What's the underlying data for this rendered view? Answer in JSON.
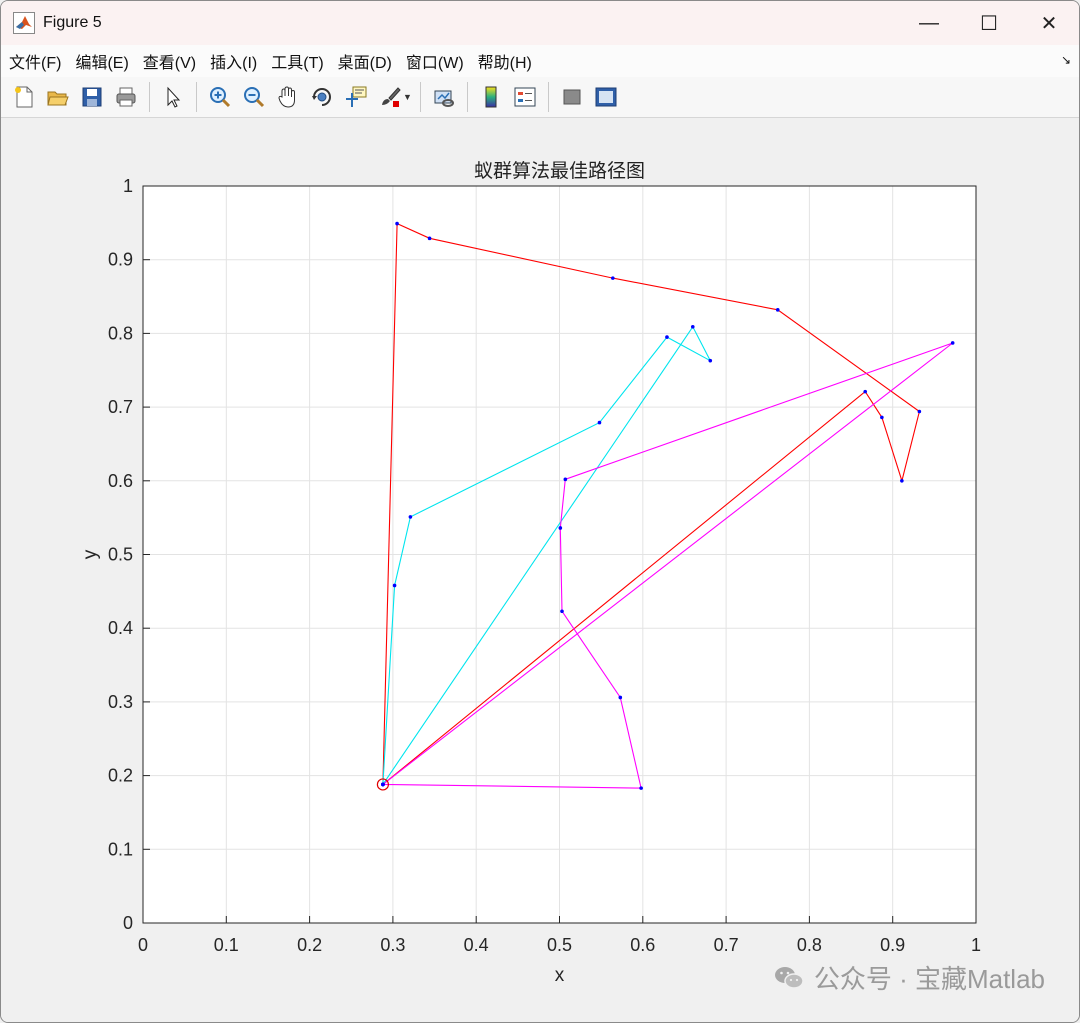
{
  "window": {
    "title": "Figure 5",
    "minimize": "—",
    "maximize": "☐",
    "close": "✕"
  },
  "menu": {
    "items": [
      "文件(F)",
      "编辑(E)",
      "查看(V)",
      "插入(I)",
      "工具(T)",
      "桌面(D)",
      "窗口(W)",
      "帮助(H)"
    ],
    "expand": "↘"
  },
  "toolbar": {
    "buttons": [
      "new-figure-icon",
      "open-file-icon",
      "save-icon",
      "print-icon",
      "pointer-icon",
      "zoom-in-icon",
      "zoom-out-icon",
      "pan-hand-icon",
      "rotate-3d-icon",
      "data-cursor-icon",
      "brush-icon",
      "link-plot-icon",
      "colorbar-icon",
      "legend-icon",
      "hide-plot-tools-icon",
      "show-plot-tools-icon"
    ]
  },
  "chart_data": {
    "type": "line",
    "title": "蚁群算法最佳路径图",
    "xlabel": "x",
    "ylabel": "y",
    "xlim": [
      0,
      1
    ],
    "ylim": [
      0,
      1
    ],
    "xticks": [
      "0",
      "0.1",
      "0.2",
      "0.3",
      "0.4",
      "0.5",
      "0.6",
      "0.7",
      "0.8",
      "0.9",
      "1"
    ],
    "yticks": [
      "0",
      "0.1",
      "0.2",
      "0.3",
      "0.4",
      "0.5",
      "0.6",
      "0.7",
      "0.8",
      "0.9",
      "1"
    ],
    "grid": true,
    "depot": {
      "x": 0.288,
      "y": 0.188
    },
    "series": [
      {
        "color": "#ff0000",
        "points": [
          [
            0.288,
            0.188
          ],
          [
            0.305,
            0.949
          ],
          [
            0.344,
            0.929
          ],
          [
            0.564,
            0.875
          ],
          [
            0.762,
            0.832
          ],
          [
            0.932,
            0.694
          ],
          [
            0.911,
            0.6
          ],
          [
            0.887,
            0.686
          ],
          [
            0.867,
            0.721
          ],
          [
            0.288,
            0.188
          ]
        ]
      },
      {
        "color": "#00e5ee",
        "points": [
          [
            0.288,
            0.188
          ],
          [
            0.302,
            0.458
          ],
          [
            0.321,
            0.551
          ],
          [
            0.548,
            0.679
          ],
          [
            0.629,
            0.795
          ],
          [
            0.681,
            0.763
          ],
          [
            0.66,
            0.809
          ],
          [
            0.288,
            0.188
          ]
        ]
      },
      {
        "color": "#ff00ff",
        "points": [
          [
            0.288,
            0.188
          ],
          [
            0.598,
            0.183
          ],
          [
            0.573,
            0.306
          ],
          [
            0.503,
            0.423
          ],
          [
            0.501,
            0.536
          ],
          [
            0.507,
            0.602
          ],
          [
            0.972,
            0.787
          ],
          [
            0.288,
            0.188
          ]
        ]
      }
    ],
    "marker_color": "#0000ff"
  },
  "watermark": {
    "text": "公众号 · 宝藏Matlab"
  }
}
